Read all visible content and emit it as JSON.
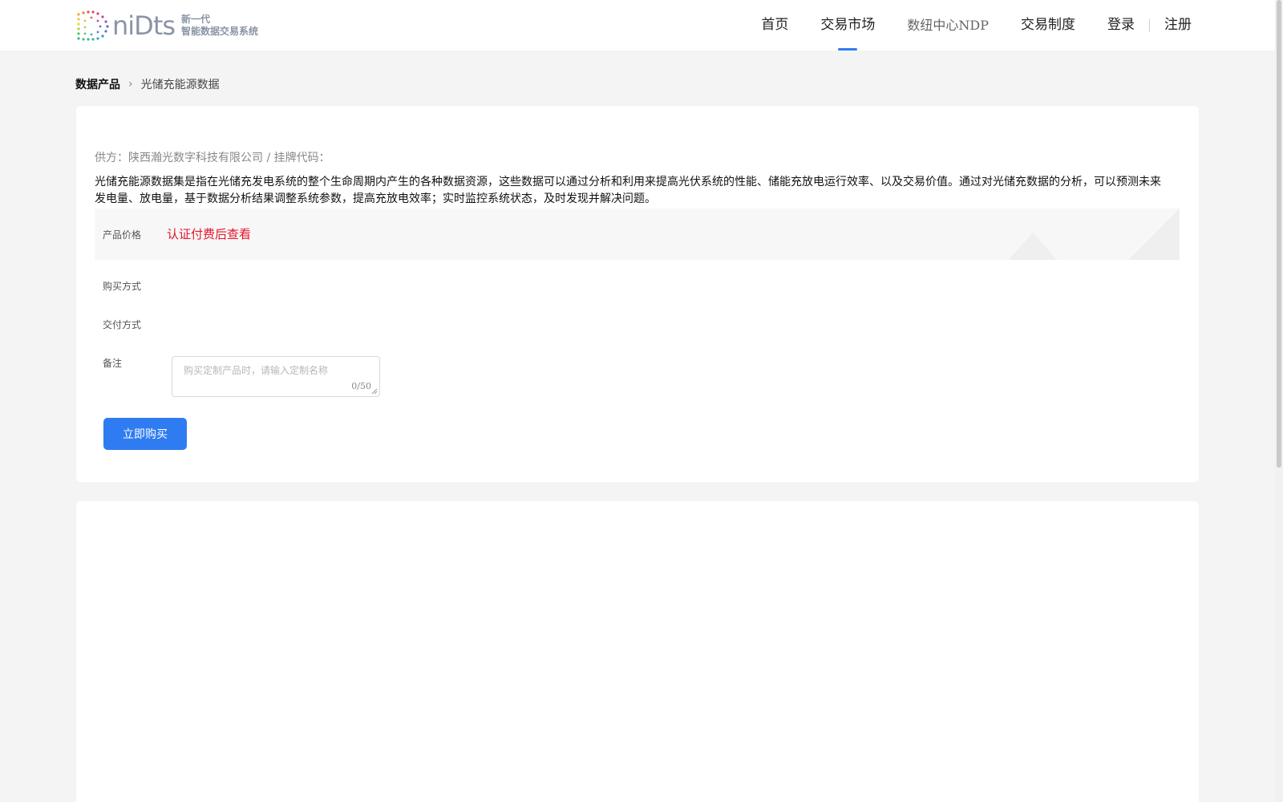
{
  "header": {
    "logo_wordmark": "niDts",
    "logo_line1": "新一代",
    "logo_line2": "智能数据交易系统",
    "nav": {
      "home": "首页",
      "market": "交易市场",
      "ndp": "数纽中心NDP",
      "rules": "交易制度",
      "login": "登录",
      "register": "注册"
    },
    "active_nav": "交易市场",
    "accent_color": "#2f7cf2"
  },
  "breadcrumb": {
    "root": "数据产品",
    "separator": "›",
    "current": "光储充能源数据"
  },
  "product": {
    "supplier_line": "供方：陕西瀚光数字科技有限公司 / 挂牌代码：",
    "description": "光储充能源数据集是指在光储充发电系统的整个生命周期内产生的各种数据资源，这些数据可以通过分析和利用来提高光伏系统的性能、储能充放电运行效率、以及交易价值。通过对光储充数据的分析，可以预测未来发电量、放电量，基于数据分析结果调整系统参数，提高充放电效率；实时监控系统状态，及时发现并解决问题。",
    "price_label": "产品价格",
    "price_value": "认证付费后查看",
    "price_color": "#e5142b",
    "buy_method_label": "购买方式",
    "delivery_label": "交付方式",
    "remark_label": "备注",
    "remark_placeholder": "购买定制产品时，请输入定制名称",
    "remark_value": "",
    "remark_count": "0/50",
    "buy_button": "立即购买"
  }
}
